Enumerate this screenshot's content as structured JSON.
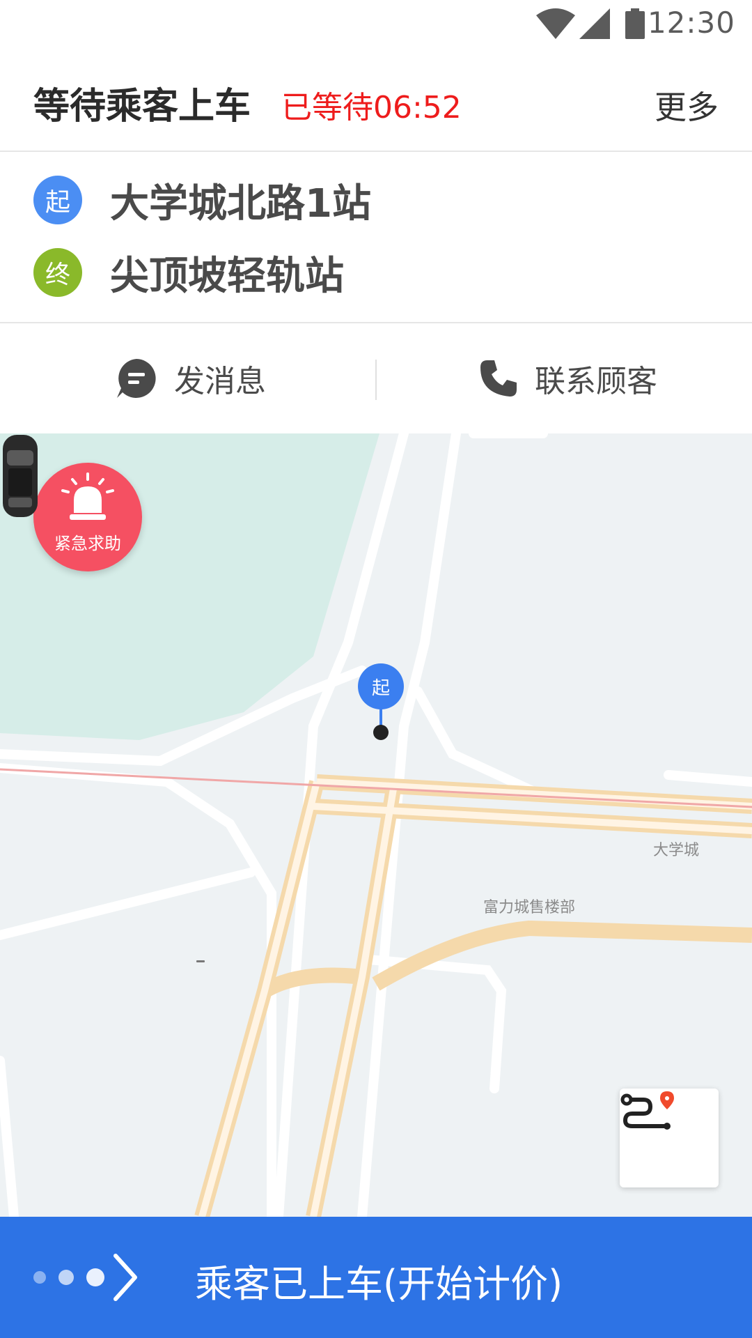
{
  "status_bar": {
    "time": "12:30",
    "icons": [
      "wifi-icon",
      "cell-signal-icon",
      "battery-icon"
    ]
  },
  "header": {
    "title": "等待乘客上车",
    "waiting": "已等待06:52",
    "more": "更多",
    "waiting_color": "#ee1c1c"
  },
  "route": {
    "start_tag": "起",
    "start_place": "大学城北路1站",
    "end_tag": "终",
    "end_place": "尖顶坡轻轨站"
  },
  "actions": {
    "message_label": "发消息",
    "call_label": "联系顾客"
  },
  "map": {
    "sos_label": "紧急求助",
    "pin_label": "起",
    "labels": [
      "大学城",
      "富力城售楼部"
    ]
  },
  "bottom_bar": {
    "label": "乘客已上车(开始计价)",
    "color": "#2d73e5"
  }
}
